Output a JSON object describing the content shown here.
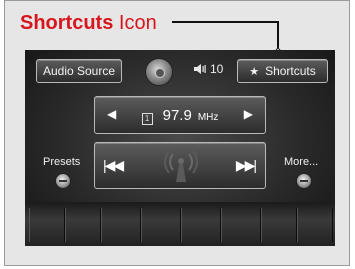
{
  "callout": {
    "bold_text": "Shortcuts",
    "regular_text": " Icon"
  },
  "screen": {
    "audio_source_label": "Audio Source",
    "shortcuts_label": "Shortcuts",
    "shortcuts_icon": "star-icon",
    "volume_level": "10",
    "frequency": "97.9",
    "frequency_unit": "MHz",
    "preset_icon_text": "1",
    "presets_label": "Presets",
    "more_label": "More..."
  },
  "colors": {
    "callout_red": "#d7161e",
    "screen_bg": "#2a2a2a"
  }
}
